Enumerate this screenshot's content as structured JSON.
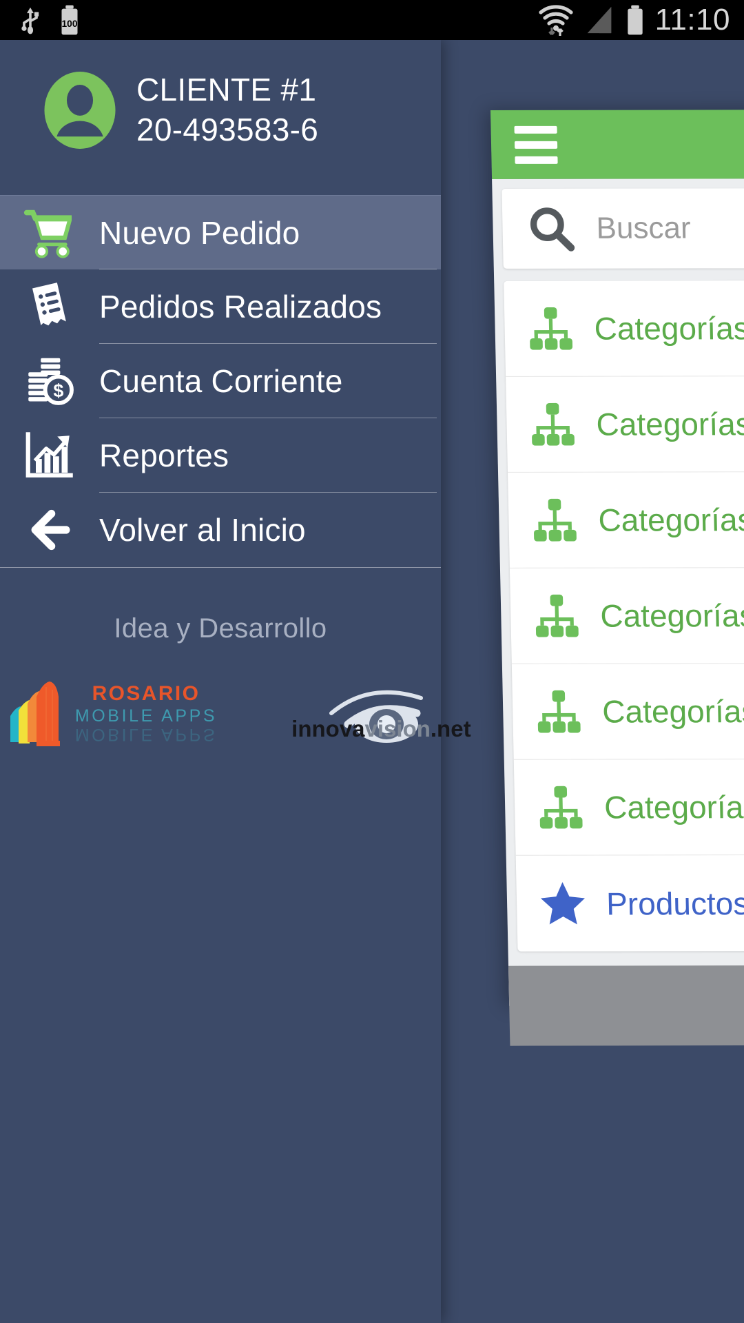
{
  "status_bar": {
    "time": "11:10",
    "battery_level_label": "100",
    "icons": [
      "usb-icon",
      "battery-charging-icon",
      "wifi-icon",
      "cell-signal-icon",
      "battery-icon"
    ]
  },
  "drawer": {
    "profile": {
      "name": "CLIENTE #1",
      "id": "20-493583-6",
      "avatar_icon": "user-avatar-icon"
    },
    "items": [
      {
        "label": "Nuevo Pedido",
        "icon": "shopping-cart-icon",
        "active": true
      },
      {
        "label": "Pedidos Realizados",
        "icon": "receipt-list-icon",
        "active": false
      },
      {
        "label": "Cuenta Corriente",
        "icon": "money-coins-icon",
        "active": false
      },
      {
        "label": "Reportes",
        "icon": "bar-chart-icon",
        "active": false
      },
      {
        "label": "Volver al Inicio",
        "icon": "arrow-left-icon",
        "active": false
      }
    ],
    "credits": {
      "title": "Idea y Desarrollo",
      "logos": [
        {
          "name": "rosario-mobile-apps-logo",
          "line1": "ROSARIO",
          "line2": "MOBILE APPS"
        },
        {
          "name": "innovavision-logo",
          "part1": "innova",
          "part2": "vision",
          "part3": ".net"
        }
      ]
    }
  },
  "background_screen": {
    "appbar": {
      "menu_icon": "hamburger-menu-icon"
    },
    "search": {
      "placeholder": "Buscar",
      "icon": "search-icon"
    },
    "list": [
      {
        "label": "Categorías",
        "icon": "sitemap-icon",
        "accent": "green"
      },
      {
        "label": "Categorías",
        "icon": "sitemap-icon",
        "accent": "green"
      },
      {
        "label": "Categorías",
        "icon": "sitemap-icon",
        "accent": "green"
      },
      {
        "label": "Categorías",
        "icon": "sitemap-icon",
        "accent": "green"
      },
      {
        "label": "Categorías",
        "icon": "sitemap-icon",
        "accent": "green"
      },
      {
        "label": "Categorías",
        "icon": "sitemap-icon",
        "accent": "green"
      },
      {
        "label": "Productos",
        "icon": "star-icon",
        "accent": "blue"
      }
    ]
  },
  "colors": {
    "drawer_bg": "#3c4a68",
    "drawer_active": "#5f6b89",
    "accent_green": "#6cbf5b",
    "list_green": "#5bab4a",
    "list_blue": "#3f63c8",
    "statusbar_bg": "#000000"
  }
}
